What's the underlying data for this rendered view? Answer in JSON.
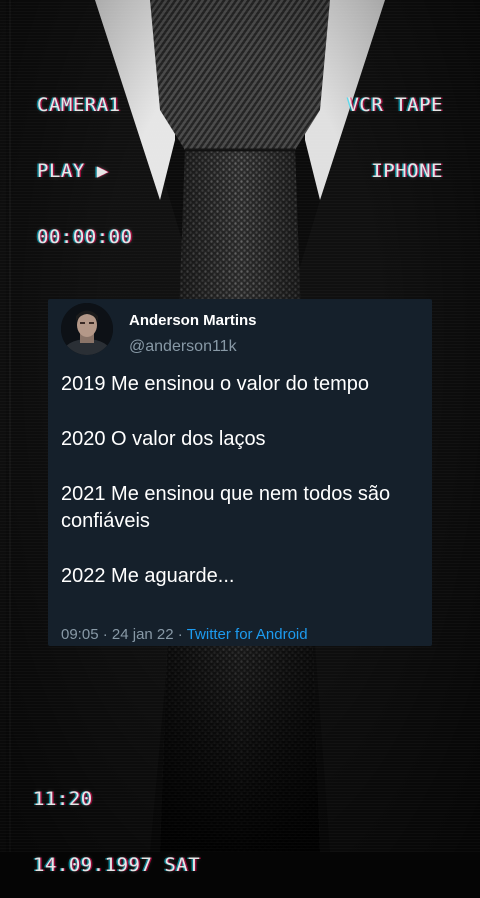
{
  "overlay": {
    "top_left": [
      "CAMERA1",
      "PLAY ▶",
      "00:00:00"
    ],
    "top_right": [
      "VCR TAPE",
      "IPHONE"
    ],
    "bottom_left": [
      "11:20",
      "14.09.1997 SAT"
    ]
  },
  "tweet": {
    "name": "Anderson Martins",
    "handle": "@anderson11k",
    "lines": [
      "2019 Me ensinou o valor do tempo",
      "2020 O valor dos laços",
      "2021 Me ensinou que nem todos são confiáveis",
      "2022 Me aguarde..."
    ],
    "time": "09:05",
    "separator": "·",
    "date": "24 jan 22",
    "source": "Twitter for Android"
  },
  "colors": {
    "card_bg": "#15202b",
    "name": "#ffffff",
    "secondary": "#8899a6",
    "link": "#1d9bf0"
  },
  "icons": [
    "play-icon",
    "avatar"
  ]
}
